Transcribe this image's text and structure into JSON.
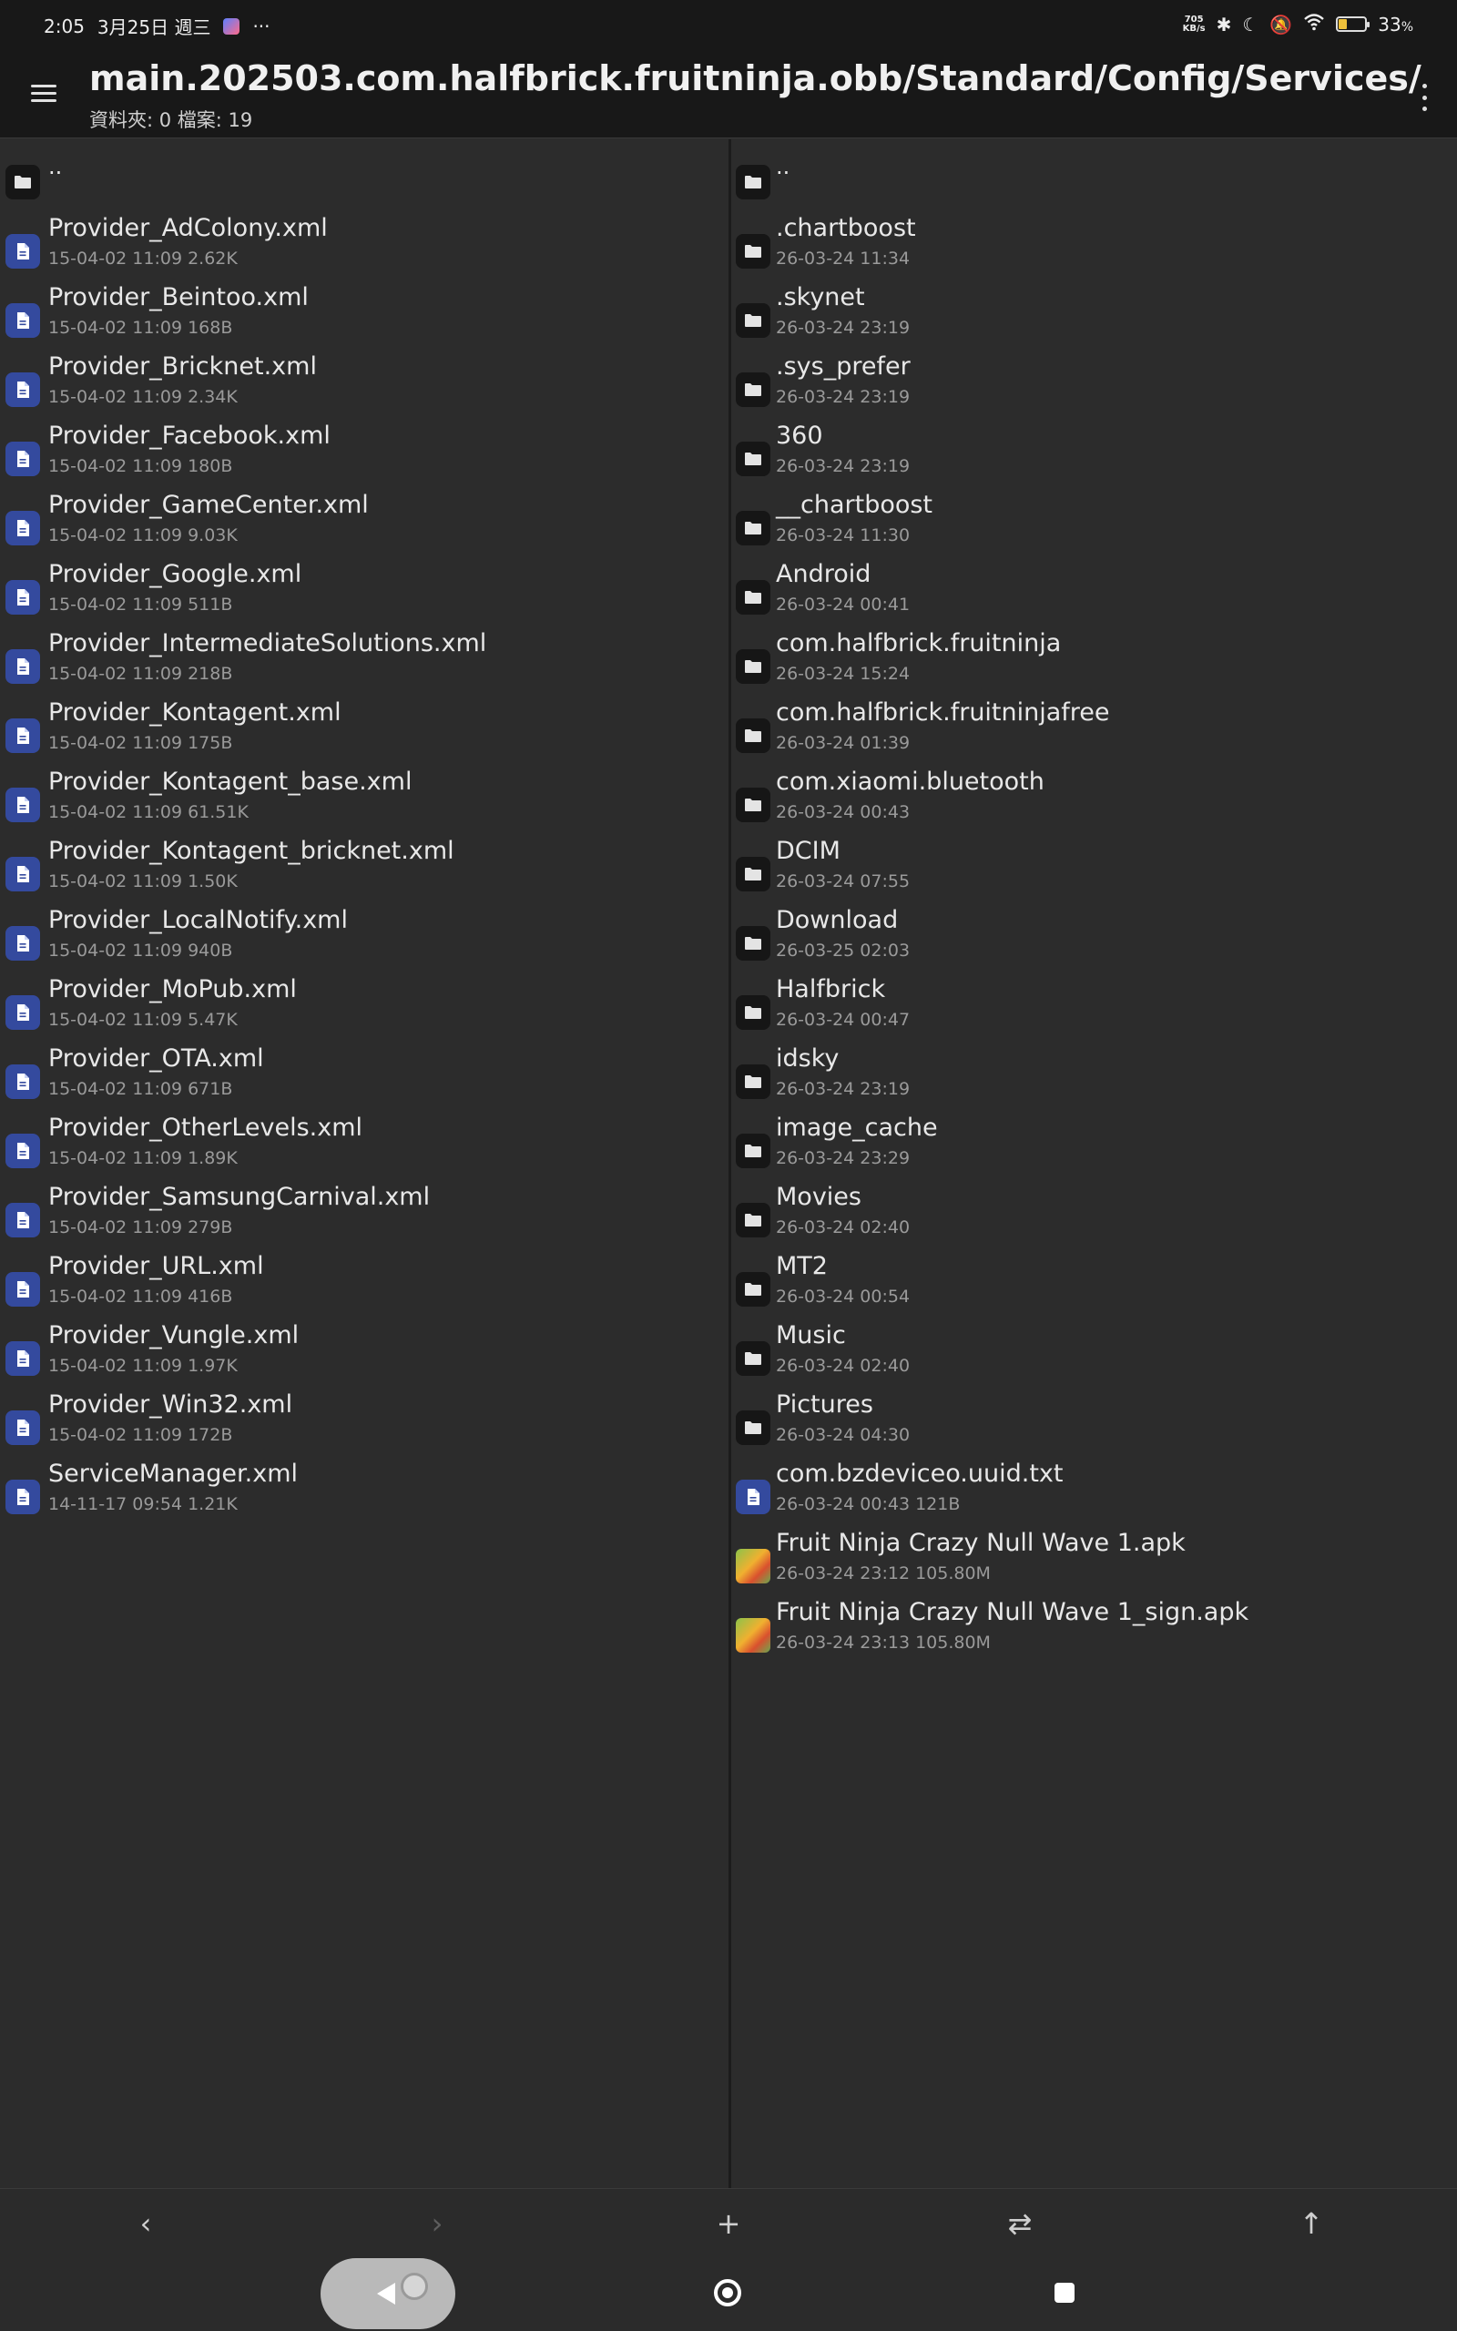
{
  "status_bar": {
    "time": "2:05",
    "date": "3月25日 週三",
    "more": "···",
    "net_speed_value": "705",
    "net_speed_unit": "KB/s",
    "battery_percent": "33",
    "battery_unit": "%",
    "battery_level": 0.33,
    "battery_color": "#f0c23b"
  },
  "header": {
    "path": "main.202503.com.halfbrick.fruitninja.obb/Standard/Config/Services/",
    "summary": "資料夾: 0  檔案: 19"
  },
  "left_pane": {
    "items": [
      {
        "type": "folder",
        "name": "..",
        "meta": ""
      },
      {
        "type": "file",
        "name": "Provider_AdColony.xml",
        "meta": "15-04-02 11:09 2.62K"
      },
      {
        "type": "file",
        "name": "Provider_Beintoo.xml",
        "meta": "15-04-02 11:09 168B"
      },
      {
        "type": "file",
        "name": "Provider_Bricknet.xml",
        "meta": "15-04-02 11:09 2.34K"
      },
      {
        "type": "file",
        "name": "Provider_Facebook.xml",
        "meta": "15-04-02 11:09 180B"
      },
      {
        "type": "file",
        "name": "Provider_GameCenter.xml",
        "meta": "15-04-02 11:09 9.03K"
      },
      {
        "type": "file",
        "name": "Provider_Google.xml",
        "meta": "15-04-02 11:09 511B"
      },
      {
        "type": "file",
        "name": "Provider_IntermediateSolutions.xml",
        "meta": "15-04-02 11:09 218B"
      },
      {
        "type": "file",
        "name": "Provider_Kontagent.xml",
        "meta": "15-04-02 11:09 175B"
      },
      {
        "type": "file",
        "name": "Provider_Kontagent_base.xml",
        "meta": "15-04-02 11:09 61.51K"
      },
      {
        "type": "file",
        "name": "Provider_Kontagent_bricknet.xml",
        "meta": "15-04-02 11:09 1.50K"
      },
      {
        "type": "file",
        "name": "Provider_LocalNotify.xml",
        "meta": "15-04-02 11:09 940B"
      },
      {
        "type": "file",
        "name": "Provider_MoPub.xml",
        "meta": "15-04-02 11:09 5.47K"
      },
      {
        "type": "file",
        "name": "Provider_OTA.xml",
        "meta": "15-04-02 11:09 671B"
      },
      {
        "type": "file",
        "name": "Provider_OtherLevels.xml",
        "meta": "15-04-02 11:09 1.89K"
      },
      {
        "type": "file",
        "name": "Provider_SamsungCarnival.xml",
        "meta": "15-04-02 11:09 279B"
      },
      {
        "type": "file",
        "name": "Provider_URL.xml",
        "meta": "15-04-02 11:09 416B"
      },
      {
        "type": "file",
        "name": "Provider_Vungle.xml",
        "meta": "15-04-02 11:09 1.97K"
      },
      {
        "type": "file",
        "name": "Provider_Win32.xml",
        "meta": "15-04-02 11:09 172B"
      },
      {
        "type": "file",
        "name": "ServiceManager.xml",
        "meta": "14-11-17 09:54 1.21K"
      }
    ]
  },
  "right_pane": {
    "items": [
      {
        "type": "folder",
        "name": "..",
        "meta": ""
      },
      {
        "type": "folder",
        "name": ".chartboost",
        "meta": "26-03-24 11:34"
      },
      {
        "type": "folder",
        "name": ".skynet",
        "meta": "26-03-24 23:19"
      },
      {
        "type": "folder",
        "name": ".sys_prefer",
        "meta": "26-03-24 23:19"
      },
      {
        "type": "folder",
        "name": "360",
        "meta": "26-03-24 23:19"
      },
      {
        "type": "folder",
        "name": "__chartboost",
        "meta": "26-03-24 11:30"
      },
      {
        "type": "folder",
        "name": "Android",
        "meta": "26-03-24 00:41"
      },
      {
        "type": "folder",
        "name": "com.halfbrick.fruitninja",
        "meta": "26-03-24 15:24"
      },
      {
        "type": "folder",
        "name": "com.halfbrick.fruitninjafree",
        "meta": "26-03-24 01:39"
      },
      {
        "type": "folder",
        "name": "com.xiaomi.bluetooth",
        "meta": "26-03-24 00:43"
      },
      {
        "type": "folder",
        "name": "DCIM",
        "meta": "26-03-24 07:55"
      },
      {
        "type": "folder",
        "name": "Download",
        "meta": "26-03-25 02:03"
      },
      {
        "type": "folder",
        "name": "Halfbrick",
        "meta": "26-03-24 00:47"
      },
      {
        "type": "folder",
        "name": "idsky",
        "meta": "26-03-24 23:19"
      },
      {
        "type": "folder",
        "name": "image_cache",
        "meta": "26-03-24 23:29"
      },
      {
        "type": "folder",
        "name": "Movies",
        "meta": "26-03-24 02:40"
      },
      {
        "type": "folder",
        "name": "MT2",
        "meta": "26-03-24 00:54"
      },
      {
        "type": "folder",
        "name": "Music",
        "meta": "26-03-24 02:40"
      },
      {
        "type": "folder",
        "name": "Pictures",
        "meta": "26-03-24 04:30"
      },
      {
        "type": "file",
        "name": "com.bzdeviceo.uuid.txt",
        "meta": "26-03-24 00:43 121B"
      },
      {
        "type": "apk",
        "name": "Fruit Ninja Crazy Null Wave 1.apk",
        "meta": "26-03-24 23:12 105.80M"
      },
      {
        "type": "apk",
        "name": "Fruit Ninja Crazy Null Wave 1_sign.apk",
        "meta": "26-03-24 23:13 105.80M"
      }
    ]
  },
  "toolbar": {
    "buttons": [
      {
        "name": "back-nav-button",
        "icon": "chevron-left-icon",
        "glyph": "‹",
        "enabled": true
      },
      {
        "name": "forward-nav-button",
        "icon": "chevron-right-icon",
        "glyph": "›",
        "enabled": false
      },
      {
        "name": "add-button",
        "icon": "plus-icon",
        "glyph": "+",
        "enabled": true
      },
      {
        "name": "swap-panes-button",
        "icon": "swap-icon",
        "glyph": "⇄",
        "enabled": true
      },
      {
        "name": "go-up-button",
        "icon": "arrow-up-icon",
        "glyph": "↑",
        "enabled": true
      }
    ]
  },
  "nav_bar": {
    "icons": [
      "back-icon",
      "home-icon",
      "recents-icon"
    ]
  }
}
